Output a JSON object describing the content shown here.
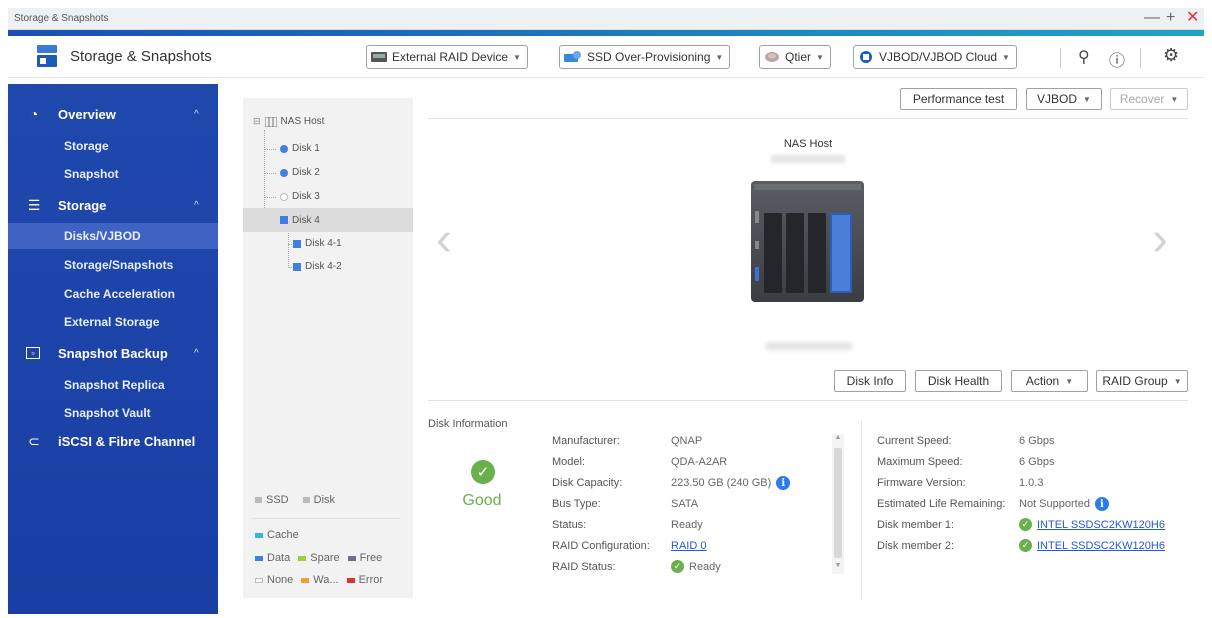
{
  "window": {
    "title": "Storage & Snapshots",
    "controls": [
      "—",
      "+",
      "✕"
    ]
  },
  "header": {
    "app_title": "Storage & Snapshots",
    "toolbar": [
      {
        "label": "External RAID Device",
        "icon": "drive-icon"
      },
      {
        "label": "SSD Over-Provisioning",
        "icon": "gear-drive-icon"
      },
      {
        "label": "Qtier",
        "icon": "qtier-icon"
      },
      {
        "label": "VJBOD/VJBOD Cloud",
        "icon": "cloud-drive-icon"
      }
    ],
    "icons": [
      "diagnostic-icon",
      "help-icon",
      "settings-icon"
    ]
  },
  "sidebar": {
    "groups": [
      {
        "label": "Overview",
        "icon": "dashboard-icon",
        "items": [
          "Storage",
          "Snapshot"
        ]
      },
      {
        "label": "Storage",
        "icon": "storage-icon",
        "items": [
          "Disks/VJBOD",
          "Storage/Snapshots",
          "Cache Acceleration",
          "External Storage"
        ]
      },
      {
        "label": "Snapshot Backup",
        "icon": "snapshot-backup-icon",
        "items": [
          "Snapshot Replica",
          "Snapshot Vault"
        ]
      },
      {
        "label": "iSCSI & Fibre Channel",
        "icon": "iscsi-icon",
        "items": []
      }
    ],
    "active_item": "Disks/VJBOD"
  },
  "tree": {
    "root": "NAS Host",
    "disks": [
      "Disk 1",
      "Disk 2",
      "Disk 3",
      "Disk 4",
      "Disk 4-1",
      "Disk 4-2"
    ],
    "selected": "Disk 4",
    "legend": {
      "types": [
        "SSD",
        "Disk"
      ],
      "cache": "Cache",
      "states": [
        "Data",
        "Spare",
        "Free",
        "None",
        "Wa...",
        "Error"
      ]
    },
    "colors": {
      "data": "#3f7fe0",
      "spare": "#9bcf3f",
      "free": "#7a6a8a",
      "cache": "#39b6d8",
      "warning": "#f0a030",
      "error": "#e03030"
    }
  },
  "main": {
    "top_buttons": {
      "performance": "Performance test",
      "vjbod": "VJBOD",
      "recover": "Recover"
    },
    "device_name": "NAS Host",
    "disk_buttons": {
      "info": "Disk Info",
      "health": "Disk Health",
      "action": "Action",
      "raid_group": "RAID Group"
    },
    "disk_information": {
      "section_title": "Disk Information",
      "status": "Good",
      "fields": [
        {
          "label": "Manufacturer:",
          "value": "QNAP"
        },
        {
          "label": "Model:",
          "value": "QDA-A2AR"
        },
        {
          "label": "Disk Capacity:",
          "value": "223.50 GB (240 GB)"
        },
        {
          "label": "Bus Type:",
          "value": "SATA"
        },
        {
          "label": "Status:",
          "value": "Ready"
        },
        {
          "label": "RAID Configuration:",
          "value": "RAID 0"
        },
        {
          "label": "RAID Status:",
          "value": "Ready"
        }
      ],
      "fields_right": [
        {
          "label": "Current Speed:",
          "value": "6 Gbps"
        },
        {
          "label": "Maximum Speed:",
          "value": "6 Gbps"
        },
        {
          "label": "Firmware Version:",
          "value": "1.0.3"
        },
        {
          "label": "Estimated Life Remaining:",
          "value": "Not Supported"
        },
        {
          "label": "Disk member 1:",
          "value": "INTEL SSDSC2KW120H6"
        },
        {
          "label": "Disk member 2:",
          "value": "INTEL SSDSC2KW120H6"
        }
      ]
    }
  }
}
